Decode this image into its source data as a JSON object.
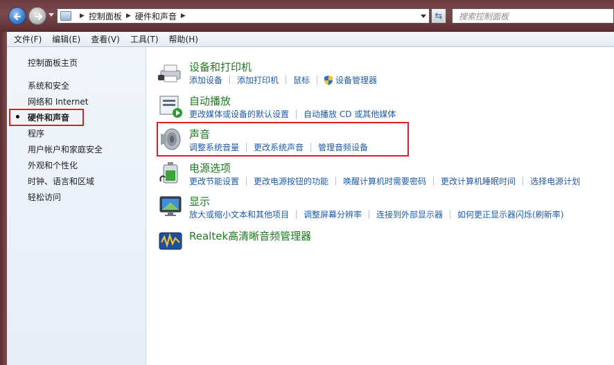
{
  "navigation": {
    "breadcrumbs": [
      "控制面板",
      "硬件和声音"
    ],
    "search_placeholder": "搜索控制面板"
  },
  "menu": [
    "文件(F)",
    "编辑(E)",
    "查看(V)",
    "工具(T)",
    "帮助(H)"
  ],
  "sidebar": {
    "items": [
      {
        "label": "控制面板主页",
        "active": false
      },
      {
        "label": "系统和安全",
        "active": false
      },
      {
        "label": "网络和 Internet",
        "active": false
      },
      {
        "label": "硬件和声音",
        "active": true
      },
      {
        "label": "程序",
        "active": false
      },
      {
        "label": "用户帐户和家庭安全",
        "active": false
      },
      {
        "label": "外观和个性化",
        "active": false
      },
      {
        "label": "时钟、语言和区域",
        "active": false
      },
      {
        "label": "轻松访问",
        "active": false
      }
    ]
  },
  "categories": [
    {
      "title": "设备和打印机",
      "icon": "printer-icon",
      "links": [
        "添加设备",
        "添加打印机",
        "鼠标",
        "设备管理器"
      ]
    },
    {
      "title": "自动播放",
      "icon": "autoplay-icon",
      "links": [
        "更改媒体或设备的默认设置",
        "自动播放 CD 或其他媒体"
      ]
    },
    {
      "title": "声音",
      "icon": "speaker-icon",
      "links": [
        "调整系统音量",
        "更改系统声音",
        "管理音频设备"
      ]
    },
    {
      "title": "电源选项",
      "icon": "battery-icon",
      "links": [
        "更改节能设置",
        "更改电源按钮的功能",
        "唤醒计算机时需要密码",
        "更改计算机睡眠时间",
        "选择电源计划"
      ]
    },
    {
      "title": "显示",
      "icon": "monitor-icon",
      "links": [
        "放大或缩小文本和其他项目",
        "调整屏幕分辨率",
        "连接到外部显示器",
        "如何更正显示器闪烁(刷新率)"
      ]
    },
    {
      "title": "Realtek高清晰音频管理器",
      "icon": "realtek-audio-icon",
      "links": []
    }
  ],
  "colors": {
    "link": "#1e5ba8",
    "category_title": "#1d7a1f",
    "highlight": "#e02020"
  }
}
